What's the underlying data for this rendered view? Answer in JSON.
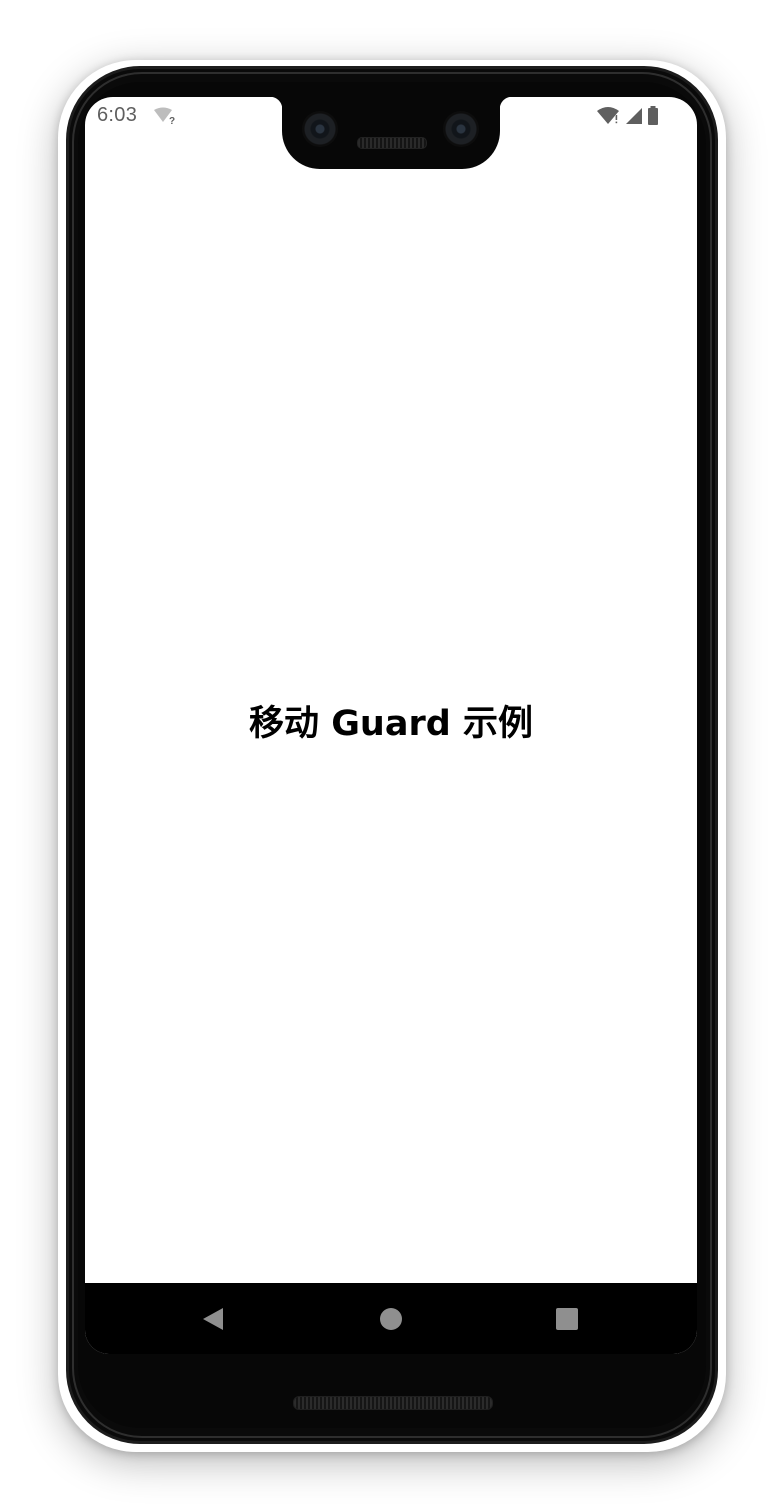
{
  "status_bar": {
    "time": "6:03",
    "left_icons": [
      "wifi-question-icon"
    ],
    "right_icons": [
      "wifi-alert-icon",
      "cell-signal-icon",
      "battery-icon"
    ]
  },
  "main": {
    "title": "移动 Guard 示例"
  },
  "nav_bar": {
    "buttons": [
      "back-icon",
      "home-icon",
      "recents-icon"
    ]
  },
  "colors": {
    "screen_background": "#ffffff",
    "title_text": "#000000",
    "nav_bar_background": "#000000",
    "nav_icon": "#8f8f8f",
    "status_icon": "#5f5f5f"
  }
}
